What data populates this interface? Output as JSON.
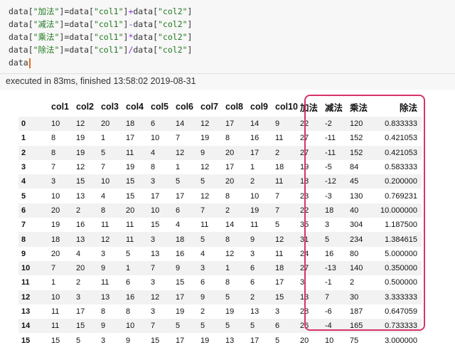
{
  "code": {
    "lines": [
      [
        [
          "data[",
          ""
        ],
        [
          "\"加法\"",
          "str"
        ],
        [
          "]=data[",
          ""
        ],
        [
          "\"col1\"",
          "str"
        ],
        [
          "]",
          ""
        ],
        [
          "+",
          "op"
        ],
        [
          "data[",
          ""
        ],
        [
          "\"col2\"",
          "str"
        ],
        [
          "]",
          ""
        ]
      ],
      [
        [
          "data[",
          ""
        ],
        [
          "\"减法\"",
          "str"
        ],
        [
          "]=data[",
          ""
        ],
        [
          "\"col1\"",
          "str"
        ],
        [
          "]",
          ""
        ],
        [
          "-",
          "op"
        ],
        [
          "data[",
          ""
        ],
        [
          "\"col2\"",
          "str"
        ],
        [
          "]",
          ""
        ]
      ],
      [
        [
          "data[",
          ""
        ],
        [
          "\"乘法\"",
          "str"
        ],
        [
          "]=data[",
          ""
        ],
        [
          "\"col1\"",
          "str"
        ],
        [
          "]",
          ""
        ],
        [
          "*",
          "op"
        ],
        [
          "data[",
          ""
        ],
        [
          "\"col2\"",
          "str"
        ],
        [
          "]",
          ""
        ]
      ],
      [
        [
          "data[",
          ""
        ],
        [
          "\"除法\"",
          "str"
        ],
        [
          "]=data[",
          ""
        ],
        [
          "\"col1\"",
          "str"
        ],
        [
          "]",
          ""
        ],
        [
          "/",
          "op"
        ],
        [
          "data[",
          ""
        ],
        [
          "\"col2\"",
          "str"
        ],
        [
          "]",
          ""
        ]
      ],
      [
        [
          "data",
          ""
        ]
      ]
    ]
  },
  "status": "executed in 83ms, finished 13:58:02 2019-08-31",
  "table": {
    "columns": [
      "",
      "col1",
      "col2",
      "col3",
      "col4",
      "col5",
      "col6",
      "col7",
      "col8",
      "col9",
      "col10",
      "加法",
      "减法",
      "乘法",
      "除法"
    ],
    "rows": [
      [
        "0",
        "10",
        "12",
        "20",
        "18",
        "6",
        "14",
        "12",
        "17",
        "14",
        "9",
        "22",
        "-2",
        "120",
        "0.833333"
      ],
      [
        "1",
        "8",
        "19",
        "1",
        "17",
        "10",
        "7",
        "19",
        "8",
        "16",
        "11",
        "27",
        "-11",
        "152",
        "0.421053"
      ],
      [
        "2",
        "8",
        "19",
        "5",
        "11",
        "4",
        "12",
        "9",
        "20",
        "17",
        "2",
        "27",
        "-11",
        "152",
        "0.421053"
      ],
      [
        "3",
        "7",
        "12",
        "7",
        "19",
        "8",
        "1",
        "12",
        "17",
        "1",
        "18",
        "19",
        "-5",
        "84",
        "0.583333"
      ],
      [
        "4",
        "3",
        "15",
        "10",
        "15",
        "3",
        "5",
        "5",
        "20",
        "2",
        "11",
        "18",
        "-12",
        "45",
        "0.200000"
      ],
      [
        "5",
        "10",
        "13",
        "4",
        "15",
        "17",
        "17",
        "12",
        "8",
        "10",
        "7",
        "23",
        "-3",
        "130",
        "0.769231"
      ],
      [
        "6",
        "20",
        "2",
        "8",
        "20",
        "10",
        "6",
        "7",
        "2",
        "19",
        "7",
        "22",
        "18",
        "40",
        "10.000000"
      ],
      [
        "7",
        "19",
        "16",
        "11",
        "11",
        "15",
        "4",
        "11",
        "14",
        "11",
        "5",
        "35",
        "3",
        "304",
        "1.187500"
      ],
      [
        "8",
        "18",
        "13",
        "12",
        "11",
        "3",
        "18",
        "5",
        "8",
        "9",
        "12",
        "31",
        "5",
        "234",
        "1.384615"
      ],
      [
        "9",
        "20",
        "4",
        "3",
        "5",
        "13",
        "16",
        "4",
        "12",
        "3",
        "11",
        "24",
        "16",
        "80",
        "5.000000"
      ],
      [
        "10",
        "7",
        "20",
        "9",
        "1",
        "7",
        "9",
        "3",
        "1",
        "6",
        "18",
        "27",
        "-13",
        "140",
        "0.350000"
      ],
      [
        "11",
        "1",
        "2",
        "11",
        "6",
        "3",
        "15",
        "6",
        "8",
        "6",
        "17",
        "3",
        "-1",
        "2",
        "0.500000"
      ],
      [
        "12",
        "10",
        "3",
        "13",
        "16",
        "12",
        "17",
        "9",
        "5",
        "2",
        "15",
        "13",
        "7",
        "30",
        "3.333333"
      ],
      [
        "13",
        "11",
        "17",
        "8",
        "8",
        "3",
        "19",
        "2",
        "19",
        "13",
        "3",
        "28",
        "-6",
        "187",
        "0.647059"
      ],
      [
        "14",
        "11",
        "15",
        "9",
        "10",
        "7",
        "5",
        "5",
        "5",
        "5",
        "6",
        "26",
        "-4",
        "165",
        "0.733333"
      ],
      [
        "15",
        "15",
        "5",
        "3",
        "9",
        "15",
        "17",
        "19",
        "13",
        "17",
        "5",
        "20",
        "10",
        "75",
        "3.000000"
      ]
    ]
  },
  "colors": {
    "highlight": "#d6336c",
    "string": "#1f7a1f",
    "operator": "#8a2be2",
    "cursor": "#e46a1e"
  }
}
